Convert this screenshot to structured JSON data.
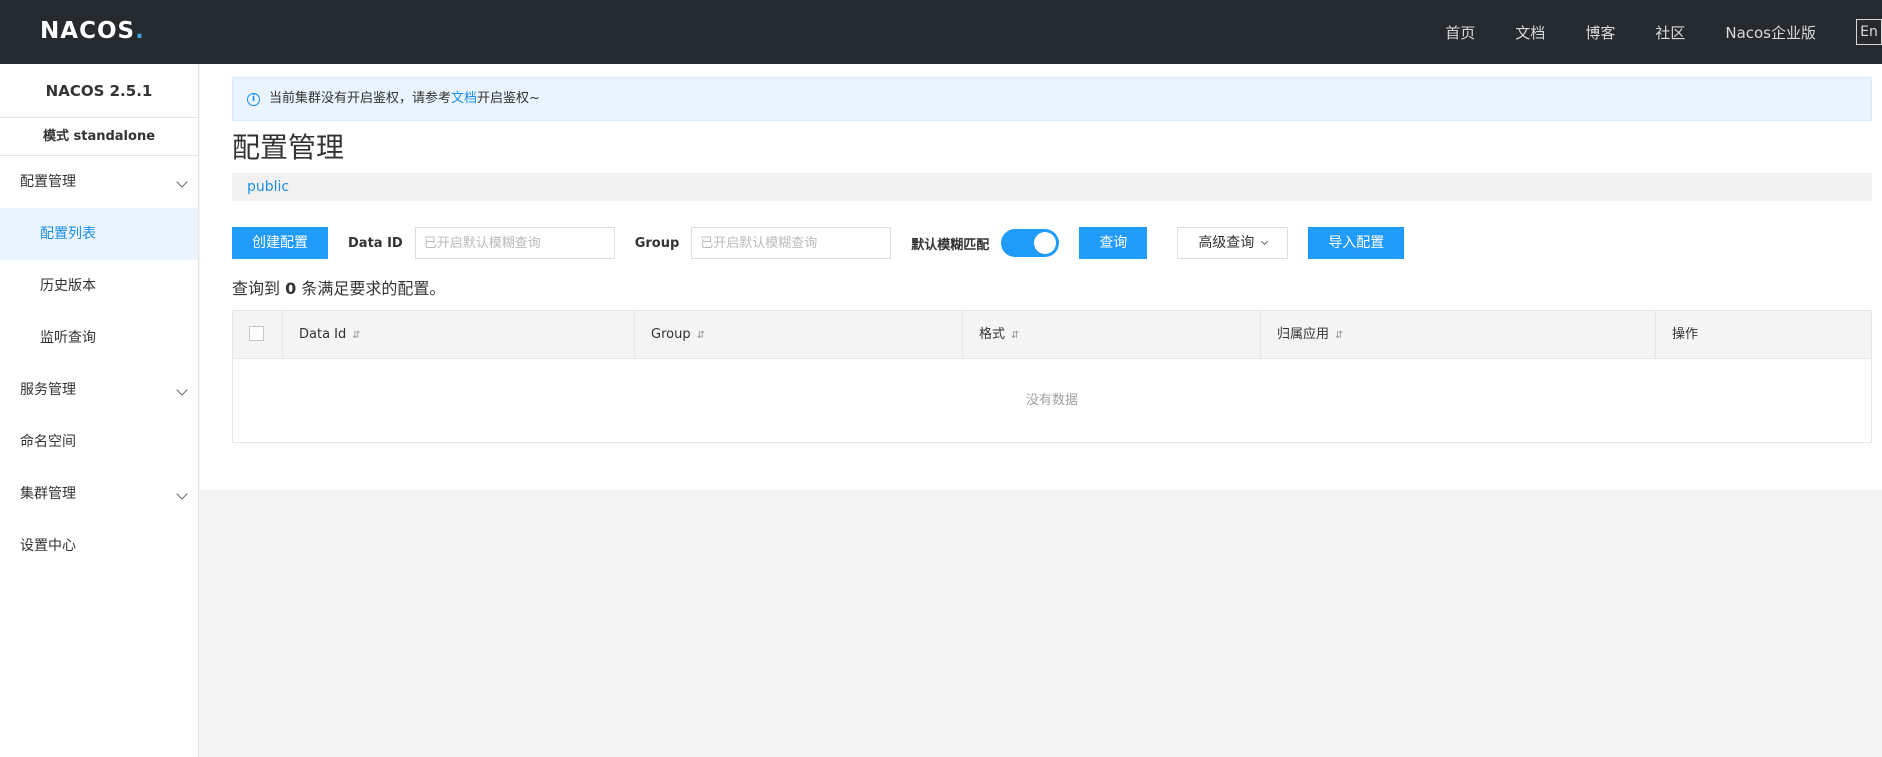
{
  "header": {
    "logo_main": "NA",
    "logo_oo": "COS",
    "logo_dot": ".",
    "nav": [
      "首页",
      "文档",
      "博客",
      "社区",
      "Nacos企业版"
    ],
    "lang": "En"
  },
  "sidebar": {
    "version": "NACOS 2.5.1",
    "mode": "模式 standalone",
    "config_group": "配置管理",
    "config_items": [
      "配置列表",
      "历史版本",
      "监听查询"
    ],
    "service_group": "服务管理",
    "namespace": "命名空间",
    "cluster_group": "集群管理",
    "settings": "设置中心"
  },
  "notice": {
    "before": "当前集群没有开启鉴权，请参考",
    "link": "文档",
    "after": "开启鉴权~",
    "icon": "info-icon"
  },
  "page": {
    "title": "配置管理",
    "namespace": "public"
  },
  "toolbar": {
    "create_label": "创建配置",
    "dataid_label": "Data ID",
    "dataid_placeholder": "已开启默认模糊查询",
    "group_label": "Group",
    "group_placeholder": "已开启默认模糊查询",
    "fuzzy_label": "默认模糊匹配",
    "fuzzy_on": true,
    "query_label": "查询",
    "advanced_label": "高级查询",
    "import_label": "导入配置"
  },
  "result": {
    "prefix": "查询到",
    "count": "0",
    "suffix": "条满足要求的配置。"
  },
  "table": {
    "columns": [
      "Data Id",
      "Group",
      "格式",
      "归属应用",
      "操作"
    ],
    "empty_text": "没有数据"
  },
  "colors": {
    "primary": "#209bfa",
    "topbar": "#252a2f",
    "active_bg": "#e9f4fe"
  }
}
